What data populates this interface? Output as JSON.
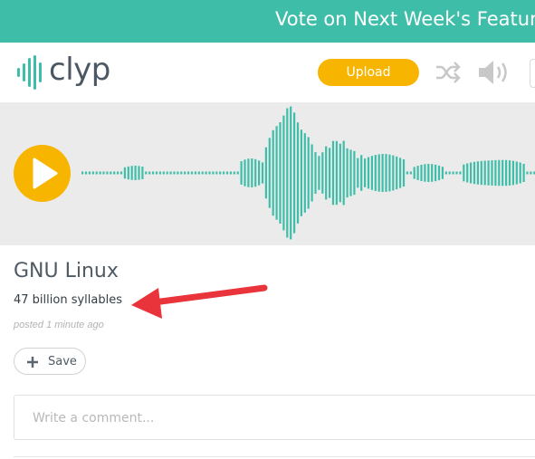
{
  "banner": {
    "text": "Vote on Next Week's Featured"
  },
  "header": {
    "logo_text": "clyp",
    "upload_label": "Upload",
    "icons": [
      "shuffle-icon",
      "volume-icon"
    ]
  },
  "player": {
    "play_icon": "play-icon",
    "waveform_color": "#3ebea9"
  },
  "track": {
    "title": "GNU Linux",
    "description": "47 billion syllables",
    "posted": "posted 1 minute ago"
  },
  "actions": {
    "save_label": "Save"
  },
  "comment": {
    "placeholder": "Write a comment..."
  },
  "colors": {
    "accent": "#3ebea9",
    "button": "#f7b500",
    "annotation_arrow": "#e8343a"
  }
}
